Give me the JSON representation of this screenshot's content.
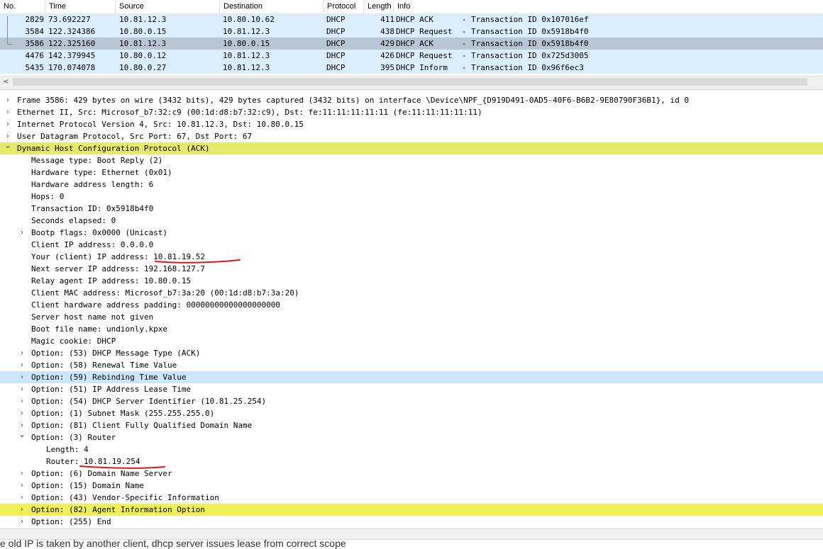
{
  "packet_list": {
    "columns": [
      "No.",
      "Time",
      "Source",
      "Destination",
      "Protocol",
      "Length",
      "Info"
    ],
    "rows": [
      {
        "no": "2829",
        "time": "73.692227",
        "src": "10.81.12.3",
        "dst": "10.80.10.62",
        "proto": "DHCP",
        "len": "411",
        "info": "DHCP ACK      - Transaction ID 0x107016ef"
      },
      {
        "no": "3584",
        "time": "122.324386",
        "src": "10.80.0.15",
        "dst": "10.81.12.3",
        "proto": "DHCP",
        "len": "438",
        "info": "DHCP Request  - Transaction ID 0x5918b4f0"
      },
      {
        "no": "3586",
        "time": "122.325160",
        "src": "10.81.12.3",
        "dst": "10.80.0.15",
        "proto": "DHCP",
        "len": "429",
        "info": "DHCP ACK      - Transaction ID 0x5918b4f0"
      },
      {
        "no": "4476",
        "time": "142.379945",
        "src": "10.80.0.12",
        "dst": "10.81.12.3",
        "proto": "DHCP",
        "len": "426",
        "info": "DHCP Request  - Transaction ID 0x725d3005"
      },
      {
        "no": "5435",
        "time": "170.074078",
        "src": "10.80.0.27",
        "dst": "10.81.12.3",
        "proto": "DHCP",
        "len": "395",
        "info": "DHCP Inform   - Transaction ID 0x96f6ec3"
      }
    ],
    "selected_row": "3586"
  },
  "details": {
    "lines": [
      {
        "text": "Frame 3586: 429 bytes on wire (3432 bits), 429 bytes captured (3432 bits) on interface \\Device\\NPF_{D919D491-0AD5-40F6-B6B2-9E80790F36B1}, id 0",
        "indent": 0,
        "chev": "right",
        "hl": ""
      },
      {
        "text": "Ethernet II, Src: Microsof_b7:32:c9 (00:1d:d8:b7:32:c9), Dst: fe:11:11:11:11:11 (fe:11:11:11:11:11)",
        "indent": 0,
        "chev": "right",
        "hl": ""
      },
      {
        "text": "Internet Protocol Version 4, Src: 10.81.12.3, Dst: 10.80.0.15",
        "indent": 0,
        "chev": "right",
        "hl": ""
      },
      {
        "text": "User Datagram Protocol, Src Port: 67, Dst Port: 67",
        "indent": 0,
        "chev": "right",
        "hl": ""
      },
      {
        "text": "Dynamic Host Configuration Protocol (ACK)",
        "indent": 0,
        "chev": "down",
        "hl": "yellow"
      },
      {
        "text": "Message type: Boot Reply (2)",
        "indent": 1,
        "chev": "",
        "hl": ""
      },
      {
        "text": "Hardware type: Ethernet (0x01)",
        "indent": 1,
        "chev": "",
        "hl": ""
      },
      {
        "text": "Hardware address length: 6",
        "indent": 1,
        "chev": "",
        "hl": ""
      },
      {
        "text": "Hops: 0",
        "indent": 1,
        "chev": "",
        "hl": ""
      },
      {
        "text": "Transaction ID: 0x5918b4f0",
        "indent": 1,
        "chev": "",
        "hl": ""
      },
      {
        "text": "Seconds elapsed: 0",
        "indent": 1,
        "chev": "",
        "hl": ""
      },
      {
        "text": "Bootp flags: 0x0000 (Unicast)",
        "indent": 1,
        "chev": "right",
        "hl": ""
      },
      {
        "text": "Client IP address: 0.0.0.0",
        "indent": 1,
        "chev": "",
        "hl": ""
      },
      {
        "text": "Your (client) IP address: 10.81.19.52",
        "indent": 1,
        "chev": "",
        "hl": ""
      },
      {
        "text": "Next server IP address: 192.168.127.7",
        "indent": 1,
        "chev": "",
        "hl": ""
      },
      {
        "text": "Relay agent IP address: 10.80.0.15",
        "indent": 1,
        "chev": "",
        "hl": ""
      },
      {
        "text": "Client MAC address: Microsof_b7:3a:20 (00:1d:d8:b7:3a:20)",
        "indent": 1,
        "chev": "",
        "hl": ""
      },
      {
        "text": "Client hardware address padding: 00000000000000000000",
        "indent": 1,
        "chev": "",
        "hl": ""
      },
      {
        "text": "Server host name not given",
        "indent": 1,
        "chev": "",
        "hl": ""
      },
      {
        "text": "Boot file name: undionly.kpxe",
        "indent": 1,
        "chev": "",
        "hl": ""
      },
      {
        "text": "Magic cookie: DHCP",
        "indent": 1,
        "chev": "",
        "hl": ""
      },
      {
        "text": "Option: (53) DHCP Message Type (ACK)",
        "indent": 1,
        "chev": "right",
        "hl": ""
      },
      {
        "text": "Option: (58) Renewal Time Value",
        "indent": 1,
        "chev": "right",
        "hl": ""
      },
      {
        "text": "Option: (59) Rebinding Time Value",
        "indent": 1,
        "chev": "right",
        "hl": "blue"
      },
      {
        "text": "Option: (51) IP Address Lease Time",
        "indent": 1,
        "chev": "right",
        "hl": ""
      },
      {
        "text": "Option: (54) DHCP Server Identifier (10.81.25.254)",
        "indent": 1,
        "chev": "right",
        "hl": ""
      },
      {
        "text": "Option: (1) Subnet Mask (255.255.255.0)",
        "indent": 1,
        "chev": "right",
        "hl": ""
      },
      {
        "text": "Option: (81) Client Fully Qualified Domain Name",
        "indent": 1,
        "chev": "right",
        "hl": ""
      },
      {
        "text": "Option: (3) Router",
        "indent": 1,
        "chev": "down",
        "hl": ""
      },
      {
        "text": "Length: 4",
        "indent": 2,
        "chev": "",
        "hl": ""
      },
      {
        "text": "Router: 10.81.19.254",
        "indent": 2,
        "chev": "",
        "hl": ""
      },
      {
        "text": "Option: (6) Domain Name Server",
        "indent": 1,
        "chev": "right",
        "hl": ""
      },
      {
        "text": "Option: (15) Domain Name",
        "indent": 1,
        "chev": "right",
        "hl": ""
      },
      {
        "text": "Option: (43) Vendor-Specific Information",
        "indent": 1,
        "chev": "right",
        "hl": ""
      },
      {
        "text": "Option: (82) Agent Information Option",
        "indent": 1,
        "chev": "right",
        "hl": "yellow2"
      },
      {
        "text": "Option: (255) End",
        "indent": 1,
        "chev": "right",
        "hl": ""
      }
    ]
  },
  "icons": {
    "chevron_right": "›",
    "chevron_down": "⌄",
    "scroll_left": "<"
  },
  "colors": {
    "row_bg": "#dbeeff",
    "row_selected": "#b6c6d4",
    "dhcp_highlight": "#e6ea6a",
    "option82_highlight": "#f0ef55",
    "option59_highlight": "#cce6ff",
    "annotation": "#d7191c"
  },
  "bottom_text": "e old IP is taken by another client, dhcp server issues lease from correct scope"
}
